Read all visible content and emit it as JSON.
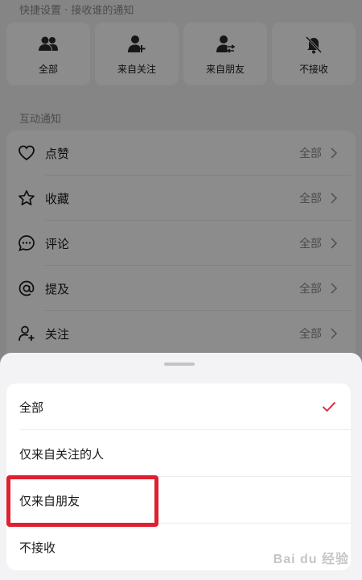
{
  "quick_settings": {
    "title": "快捷设置 · 接收谁的通知",
    "cards": [
      {
        "label": "全部",
        "icon": "users-icon"
      },
      {
        "label": "来自关注",
        "icon": "user-plus-icon"
      },
      {
        "label": "来自朋友",
        "icon": "user-swap-icon"
      },
      {
        "label": "不接收",
        "icon": "bell-off-icon"
      }
    ]
  },
  "interactions": {
    "title": "互动通知",
    "items": [
      {
        "label": "点赞",
        "value": "全部",
        "icon": "heart-icon"
      },
      {
        "label": "收藏",
        "value": "全部",
        "icon": "star-icon"
      },
      {
        "label": "评论",
        "value": "全部",
        "icon": "comment-icon"
      },
      {
        "label": "提及",
        "value": "全部",
        "icon": "at-icon"
      },
      {
        "label": "关注",
        "value": "全部",
        "icon": "follow-icon"
      }
    ]
  },
  "sheet": {
    "options": [
      {
        "label": "全部",
        "selected": true
      },
      {
        "label": "仅来自关注的人",
        "selected": false
      },
      {
        "label": "仅来自朋友",
        "selected": false
      },
      {
        "label": "不接收",
        "selected": false
      }
    ]
  },
  "watermark": {
    "text": "Bai du 经验"
  },
  "colors": {
    "accent": "#e0304a",
    "highlight": "#e02030"
  }
}
